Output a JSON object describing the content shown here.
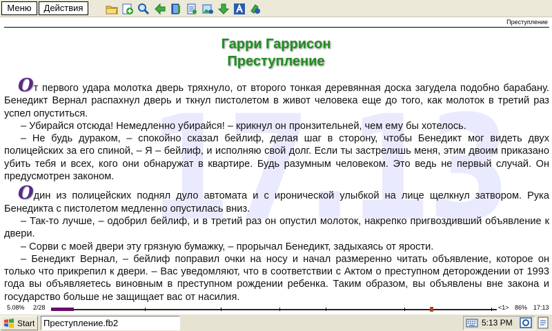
{
  "toolbar": {
    "menu_label": "Меню",
    "actions_label": "Действия",
    "icons": [
      "open-folder-icon",
      "add-bookmark-icon",
      "search-icon",
      "back-arrow-icon",
      "book-icon",
      "contents-icon",
      "image-icon",
      "down-arrow-icon",
      "font-icon",
      "settings-icon"
    ]
  },
  "reader": {
    "running_header": "Преступление",
    "watermark": "17.13",
    "author": "Гарри Гаррисон",
    "title": "Преступление",
    "p1_dropcap": "О",
    "p1": "т первого удара молотка дверь тряхнуло, от второго тонкая деревянная доска загудела подобно барабану. Бенедикт Вернал распахнул дверь и ткнул пистолетом в живот человека еще до того, как молоток в третий раз успел опуститься.",
    "p2": "– Убирайся отсюда! Немедленно убирайся! – крикнул он пронзительней, чем ему бы хотелось.",
    "p3": "– Не будь дураком, – спокойно сказал бейлиф, делая шаг в сторону, чтобы Бенедикт мог видеть двух полицейских за его спиной, – Я – бейлиф, и исполняю свой долг. Если ты застрелишь меня, этим двоим приказано убить тебя и всех, кого они обнаружат в квартире. Будь разумным человеком. Это ведь не первый случай. Он предусмотрен законом.",
    "p4_dropcap": "О",
    "p4": "дин из полицейских поднял дуло автомата и с иронической улыбкой на лице щелкнул затвором. Рука Бенедикта с пистолетом медленно опустилась вниз.",
    "p5": "– Так-то лучше, – одобрил бейлиф, и в третий раз он опустил молоток, накрепко пригвоздивший объявление к двери.",
    "p6": "– Сорви с моей двери эту грязную бумажку, – прорычал Бенедикт, задыхаясь от ярости.",
    "p7": "– Бенедикт Вернал, – бейлиф поправил очки на носу и начал размеренно читать объявление, которое он только что прикрепил к двери. – Вас уведомляют, что в соответствии с Актом о преступном деторождении от 1993 года вы объявляетесь виновным в преступном рождении ребенка. Таким образом, вы объявлены вне закона и государство больше не защищает вас от насилия."
  },
  "status": {
    "percent": "5.08%",
    "pages": "2/28",
    "progress_fraction": 0.0508,
    "chapter": "<1>",
    "battery": "86%",
    "time": "17:13",
    "progress_color": "#6a0e6a",
    "marker_color": "#b04a1a"
  },
  "taskbar": {
    "start_label": "Start",
    "task_item": "Преступление.fb2",
    "clock": "5:13 PM"
  },
  "colors": {
    "title_green": "#1f8f1f",
    "dropcap_purple": "#5a2a8a",
    "toolbar_bg": "#ece9d8"
  }
}
